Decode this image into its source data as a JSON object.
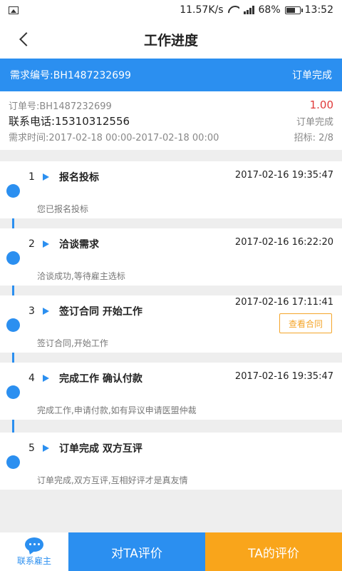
{
  "statusbar": {
    "speed": "11.57K/s",
    "battery": "68%",
    "time": "13:52",
    "icons": [
      "image-icon",
      "wifi-icon",
      "signal-icon",
      "battery-icon"
    ]
  },
  "nav": {
    "title": "工作进度"
  },
  "req_bar": {
    "label": "需求编号:BH1487232699",
    "status": "订单完成"
  },
  "order": {
    "order_no": "订单号:BH1487232699",
    "price": "1.00",
    "phone": "联系电话:15310312556",
    "state": "订单完成",
    "time_range": "需求时间:2017-02-18 00:00-2017-02-18 00:00",
    "bids": "招标: 2/8"
  },
  "steps": [
    {
      "num": "1",
      "title": "报名投标",
      "time": "2017-02-16 19:35:47",
      "desc": "您已报名投标"
    },
    {
      "num": "2",
      "title": "洽谈需求",
      "time": "2017-02-16 16:22:20",
      "desc": "洽谈成功,等待雇主选标"
    },
    {
      "num": "3",
      "title": "签订合同 开始工作",
      "time": "2017-02-16 17:11:41",
      "desc": "签订合同,开始工作",
      "button": "查看合同"
    },
    {
      "num": "4",
      "title": "完成工作 确认付款",
      "time": "2017-02-16 19:35:47",
      "desc": "完成工作,申请付款,如有异议申请医盟仲裁"
    },
    {
      "num": "5",
      "title": "订单完成 双方互评",
      "time": "",
      "desc": "订单完成,双方互评,互相好评才是真友情"
    }
  ],
  "bottom": {
    "contact": "联系雇主",
    "rate": "对TA评价",
    "ta_rating": "TA的评价"
  },
  "colors": {
    "primary": "#2b8ff0",
    "accent": "#f9a51b",
    "price": "#e03a3a"
  }
}
